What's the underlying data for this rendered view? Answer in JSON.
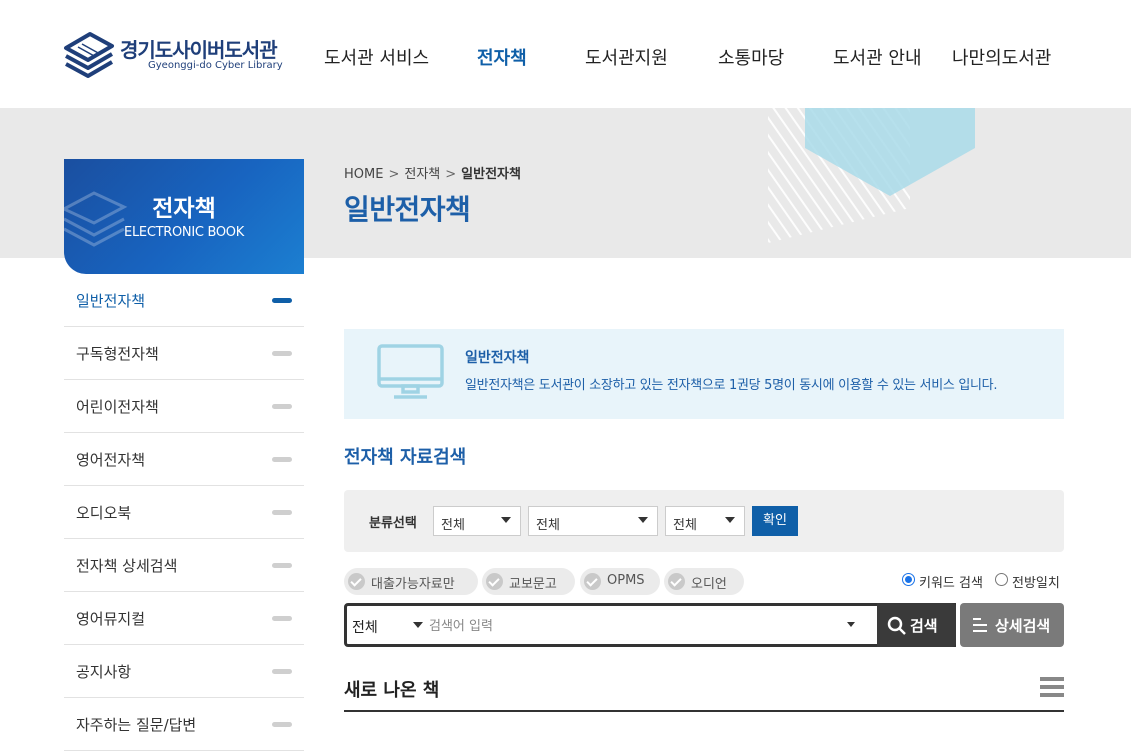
{
  "header": {
    "logo_ko": "경기도사이버도서관",
    "logo_en": "Gyeonggi-do Cyber Library",
    "nav": [
      {
        "label": "도서관 서비스",
        "active": false
      },
      {
        "label": "전자책",
        "active": true
      },
      {
        "label": "도서관지원",
        "active": false
      },
      {
        "label": "소통마당",
        "active": false
      },
      {
        "label": "도서관 안내",
        "active": false
      },
      {
        "label": "나만의도서관",
        "active": false
      }
    ]
  },
  "sidebar": {
    "title": "전자책",
    "subtitle": "ELECTRONIC BOOK",
    "items": [
      {
        "label": "일반전자책",
        "active": true
      },
      {
        "label": "구독형전자책",
        "active": false
      },
      {
        "label": "어린이전자책",
        "active": false
      },
      {
        "label": "영어전자책",
        "active": false
      },
      {
        "label": "오디오북",
        "active": false
      },
      {
        "label": "전자책 상세검색",
        "active": false
      },
      {
        "label": "영어뮤지컬",
        "active": false
      },
      {
        "label": "공지사항",
        "active": false
      },
      {
        "label": "자주하는 질문/답변",
        "active": false
      }
    ]
  },
  "breadcrumb": {
    "home": "HOME",
    "sep": ">",
    "level1": "전자책",
    "current": "일반전자책"
  },
  "page_title": "일반전자책",
  "info": {
    "title": "일반전자책",
    "description": "일반전자책은 도서관이 소장하고 있는 전자책으로 1권당 5명이 동시에 이용할 수 있는 서비스 입니다."
  },
  "search_section": {
    "title": "전자책 자료검색",
    "filter_label": "분류선택",
    "selects": [
      "전체",
      "전체",
      "전체"
    ],
    "confirm_label": "확인",
    "chips": [
      "대출가능자료만",
      "교보문고",
      "OPMS",
      "오디언"
    ],
    "radios": [
      {
        "label": "키워드 검색",
        "checked": true
      },
      {
        "label": "전방일치",
        "checked": false
      }
    ],
    "scope_value": "전체",
    "placeholder": "검색어 입력",
    "search_label": "검색",
    "advanced_label": "상세검색"
  },
  "new_books": {
    "title": "새로 나온 책"
  },
  "colors": {
    "brand_blue": "#0f5fa8",
    "title_blue": "#1d5fa8",
    "info_bg": "#e8f4fa",
    "band_bg": "#e9e9e9"
  },
  "icons": {
    "logo": "book-stack-icon",
    "info": "monitor-icon",
    "search": "magnifier-icon",
    "advanced": "filter-lines-icon",
    "list": "hamburger-list-icon"
  }
}
